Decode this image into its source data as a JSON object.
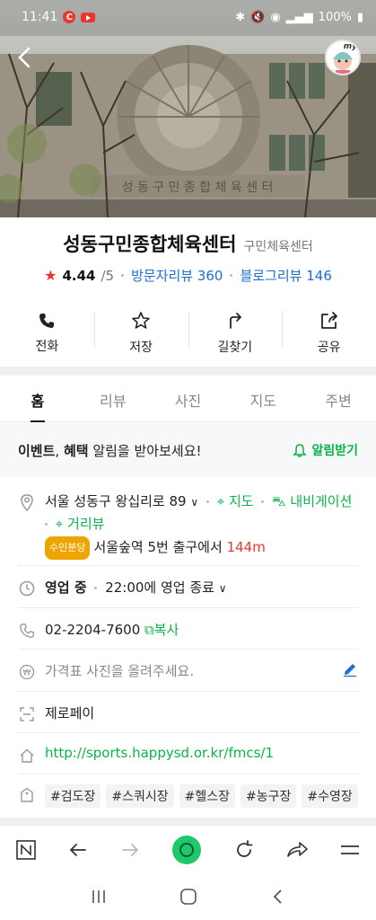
{
  "status_bar": {
    "time": "11:41",
    "notif_c": "C",
    "battery": "100%"
  },
  "place": {
    "name": "성동구민종합체육센터",
    "category": "구민체육센터",
    "rating": "4.44",
    "rating_max": "/5",
    "visitor_reviews": "방문자리뷰 360",
    "blog_reviews": "블로그리뷰 146"
  },
  "actions": [
    {
      "label": "전화",
      "icon": "phone-icon"
    },
    {
      "label": "저장",
      "icon": "star-icon"
    },
    {
      "label": "길찾기",
      "icon": "directions-icon"
    },
    {
      "label": "공유",
      "icon": "share-icon"
    }
  ],
  "tabs": [
    {
      "label": "홈",
      "active": true
    },
    {
      "label": "리뷰"
    },
    {
      "label": "사진"
    },
    {
      "label": "지도"
    },
    {
      "label": "주변"
    }
  ],
  "notice": {
    "bold1": "이벤트",
    "sep": ", ",
    "bold2": "혜택",
    "text": " 알림을 받아보세요!",
    "alarm_label": "알림받기"
  },
  "address": {
    "text": "서울 성동구 왕십리로 89",
    "map_link": "지도",
    "navi_link": "내비게이션",
    "street_view": "거리뷰",
    "subway_badge": "수인분당",
    "station": "서울숲역",
    "exit_text": "5번 출구에서",
    "distance": "144m"
  },
  "hours": {
    "status": "영업 중",
    "detail": "22:00에 영업 종료"
  },
  "phone": {
    "number": "02-2204-7600",
    "copy_label": "복사"
  },
  "price": {
    "placeholder": "가격표 사진을 올려주세요."
  },
  "payment": {
    "text": "제로페이"
  },
  "website": {
    "url": "http://sports.happysd.or.kr/fmcs/1"
  },
  "tags": [
    "#검도장",
    "#스쿼시장",
    "#헬스장",
    "#농구장",
    "#수영장"
  ],
  "colors": {
    "accent_green": "#0bb34a",
    "link_blue": "#1a6fd1",
    "star_red": "#e8382c",
    "badge_orange": "#f0a400"
  }
}
